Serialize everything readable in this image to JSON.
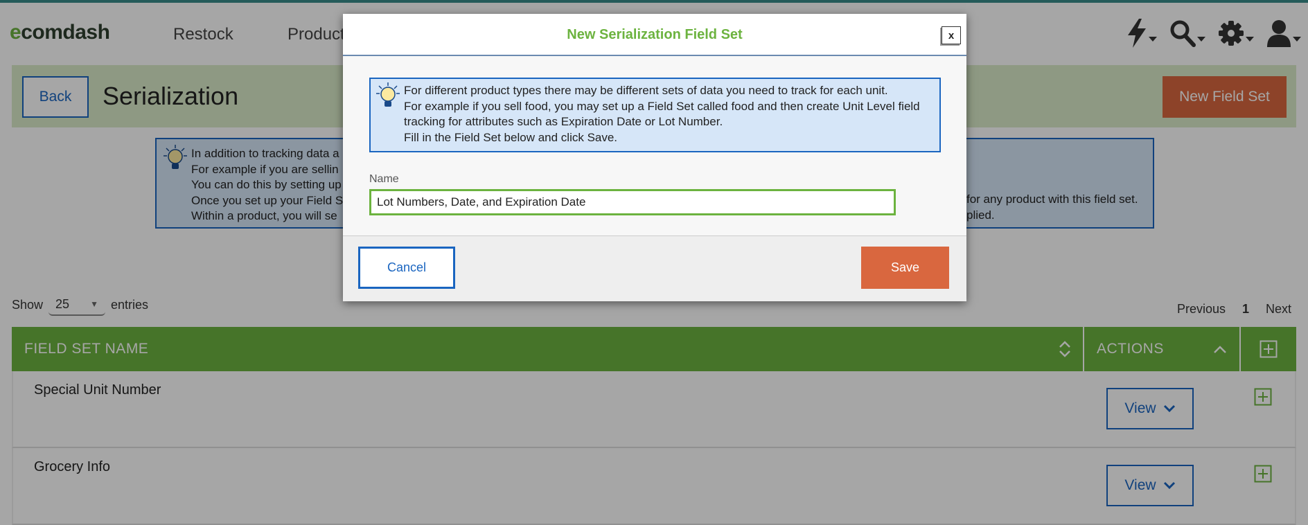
{
  "colors": {
    "brand_green": "#6cb33f",
    "accent_orange": "#d9673f",
    "link_blue": "#1a65c0",
    "info_bg": "#d6e6f8",
    "header_bg": "#dbebc9"
  },
  "nav": {
    "logo": "ecomdash",
    "items": [
      "Restock",
      "Products"
    ],
    "icons": [
      "lightning-icon",
      "search-icon",
      "gear-icon",
      "user-icon"
    ]
  },
  "page": {
    "back_label": "Back",
    "title": "Serialization",
    "new_fieldset_label": "New Field Set"
  },
  "info": {
    "lines": [
      "In addition to tracking data a",
      "For example if you are sellin",
      "You can do this by setting up",
      "Once you set up your Field S",
      "Within a product, you will se"
    ],
    "right_lines": [
      "for any product with this field set.",
      "plied."
    ]
  },
  "table_controls": {
    "show_label": "Show",
    "entries_value": "25",
    "entries_label": "entries",
    "previous_label": "Previous",
    "current_page": "1",
    "next_label": "Next"
  },
  "table": {
    "headers": {
      "name": "FIELD SET NAME",
      "actions": "ACTIONS"
    },
    "rows": [
      {
        "name": "Special Unit Number",
        "action_label": "View"
      },
      {
        "name": "Grocery Info",
        "action_label": "View"
      }
    ]
  },
  "modal": {
    "title": "New Serialization Field Set",
    "close_label": "x",
    "info_lines": [
      "For different product types there may be different sets of data you need to track for each unit.",
      "For example if you sell food, you may set up a Field Set called food and then create Unit Level field",
      "tracking for attributes such as Expiration Date or Lot Number.",
      "Fill in the Field Set below and click Save."
    ],
    "name_label": "Name",
    "name_value": "Lot Numbers, Date, and Expiration Date",
    "cancel_label": "Cancel",
    "save_label": "Save"
  }
}
